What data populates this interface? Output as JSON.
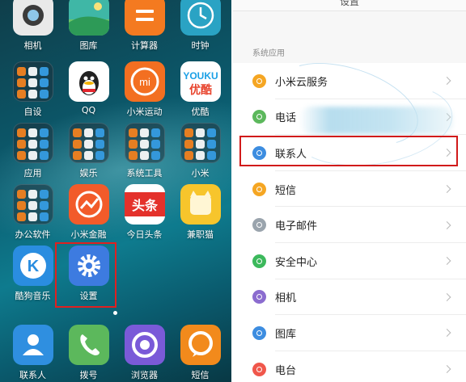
{
  "home": {
    "rows": [
      [
        {
          "label": "相机",
          "icon": "camera-icon",
          "bg": "#e9e9e9"
        },
        {
          "label": "图库",
          "icon": "gallery-icon",
          "bg": "#3fb7a6"
        },
        {
          "label": "计算器",
          "icon": "calculator-icon",
          "bg": "#f47a20"
        },
        {
          "label": "时钟",
          "icon": "clock-icon",
          "bg": "#2aa3c4"
        }
      ],
      [
        {
          "label": "自设",
          "icon": "folder-icon",
          "folder": true
        },
        {
          "label": "QQ",
          "icon": "qq-icon",
          "bg": "#ffffff"
        },
        {
          "label": "小米运动",
          "icon": "mi-fit-icon",
          "bg": "#f36f21"
        },
        {
          "label": "优酷",
          "icon": "youku-icon",
          "bg": "#ffffff"
        }
      ],
      [
        {
          "label": "应用",
          "icon": "folder-icon",
          "folder": true
        },
        {
          "label": "娱乐",
          "icon": "folder-icon",
          "folder": true
        },
        {
          "label": "系统工具",
          "icon": "folder-icon",
          "folder": true
        },
        {
          "label": "小米",
          "icon": "folder-icon",
          "folder": true
        }
      ],
      [
        {
          "label": "办公软件",
          "icon": "folder-icon",
          "folder": true
        },
        {
          "label": "小米金融",
          "icon": "mi-finance-icon",
          "bg": "#f25b2a"
        },
        {
          "label": "今日头条",
          "icon": "toutiao-icon",
          "bg": "#ffffff"
        },
        {
          "label": "兼职猫",
          "icon": "jianzhimao-icon",
          "bg": "#f7c52c"
        }
      ],
      [
        {
          "label": "酷狗音乐",
          "icon": "kugou-icon",
          "bg": "#2a8de0"
        },
        {
          "label": "设置",
          "icon": "settings-gear-icon",
          "bg": "#3d7be0"
        }
      ]
    ],
    "dock": [
      {
        "label": "联系人",
        "icon": "contacts-icon",
        "bg": "#2f8fe0"
      },
      {
        "label": "拨号",
        "icon": "phone-icon",
        "bg": "#5cb85c"
      },
      {
        "label": "浏览器",
        "icon": "browser-icon",
        "bg": "#7a5ad8"
      },
      {
        "label": "短信",
        "icon": "sms-icon",
        "bg": "#f28a1c"
      }
    ],
    "youku_text_top": "YOUKU",
    "youku_text_bottom": "优酷",
    "toutiao_text": "头条",
    "qq_text": "QQ",
    "mi_text": "mi",
    "kugou_text": "K"
  },
  "settings": {
    "header_title": "设置",
    "section_title": "系统应用",
    "items": [
      {
        "label": "小米云服务",
        "icon": "cloud-icon",
        "color": "#f5a623"
      },
      {
        "label": "电话",
        "icon": "phone-icon",
        "color": "#5cb85c"
      },
      {
        "label": "联系人",
        "icon": "contacts-icon",
        "color": "#3d8de0"
      },
      {
        "label": "短信",
        "icon": "sms-icon",
        "color": "#f5a623"
      },
      {
        "label": "电子邮件",
        "icon": "mail-icon",
        "color": "#9aa4ad"
      },
      {
        "label": "安全中心",
        "icon": "shield-icon",
        "color": "#3cb95c"
      },
      {
        "label": "相机",
        "icon": "camera-icon",
        "color": "#8b6ccf"
      },
      {
        "label": "图库",
        "icon": "gallery-icon",
        "color": "#3d8de0"
      },
      {
        "label": "电台",
        "icon": "radio-icon",
        "color": "#f0574b"
      }
    ]
  },
  "accent": "#e02020"
}
